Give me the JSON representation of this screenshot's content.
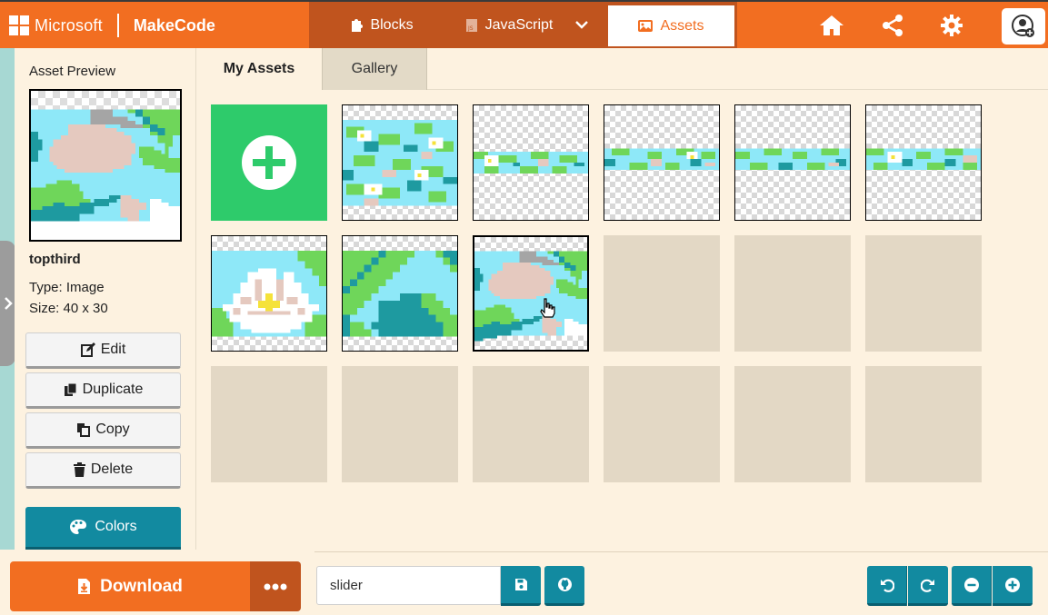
{
  "header": {
    "brand": "Microsoft",
    "product": "MakeCode",
    "tabs": [
      {
        "label": "Blocks",
        "icon": "puzzle-icon"
      },
      {
        "label": "JavaScript",
        "icon": "js-file-icon"
      },
      {
        "label": "Assets",
        "icon": "image-icon",
        "active": true
      }
    ],
    "actions": [
      "home-icon",
      "share-icon",
      "gear-icon",
      "user-avatar-icon"
    ]
  },
  "sidebar": {
    "preview_label": "Asset Preview",
    "asset_name": "topthird",
    "type_text": "Type: Image",
    "size_text": "Size: 40 x 30",
    "buttons": {
      "edit": "Edit",
      "duplicate": "Duplicate",
      "copy": "Copy",
      "delete": "Delete",
      "colors": "Colors"
    }
  },
  "main": {
    "tabs": [
      {
        "label": "My Assets",
        "active": true
      },
      {
        "label": "Gallery"
      }
    ],
    "grid": {
      "rows": [
        [
          "add",
          "lily-pads-tile",
          "lily-strip-1",
          "lily-strip-2",
          "lily-strip-3",
          "lily-strip-4"
        ],
        [
          "water-lily-flower",
          "lily-pad-closeup",
          "topthird-selected",
          "empty",
          "empty",
          "empty"
        ],
        [
          "empty",
          "empty",
          "empty",
          "empty",
          "empty",
          "empty"
        ]
      ]
    }
  },
  "footer": {
    "download_label": "Download",
    "project_name": "slider"
  },
  "colors": {
    "accent": "#f26e21",
    "accent_dark": "#c0541e",
    "teal": "#128aa0",
    "add_green": "#2ecb6b",
    "water": "#8ee8f8",
    "lily_green": "#6fd65a",
    "pad_pink": "#e5c9bf",
    "dark_teal": "#1e9aa0"
  }
}
